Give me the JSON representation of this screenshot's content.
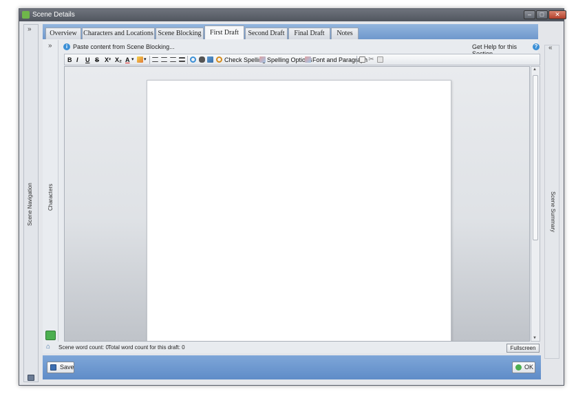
{
  "window": {
    "title": "Scene Details",
    "controls": {
      "minimize": "–",
      "maximize": "□",
      "close": "✕"
    }
  },
  "side_panels": {
    "left_label": "Scene Navigation",
    "left_toggle": "»",
    "characters_label": "Characters",
    "characters_toggle": "»",
    "right_label": "Scene Summary",
    "right_toggle": "«"
  },
  "tabs": [
    {
      "label": "Overview"
    },
    {
      "label": "Characters and Locations"
    },
    {
      "label": "Scene Blocking"
    },
    {
      "label": "First Draft"
    },
    {
      "label": "Second Draft"
    },
    {
      "label": "Final Draft"
    },
    {
      "label": "Notes"
    }
  ],
  "active_tab": "First Draft",
  "top_actions": {
    "paste_label": "Paste content from Scene Blocking...",
    "help_label": "Get Help for this Section..."
  },
  "format_toolbar": {
    "bold": "B",
    "italic": "I",
    "underline": "U",
    "strike": "S",
    "superscript": "X²",
    "subscript": "X₂",
    "font_color": "A",
    "dropdown": "▾",
    "check_spelling": "Check Spelling",
    "spelling_options": "Spelling Options",
    "font_paragraph": "Font and Paragraph"
  },
  "status": {
    "scene_word_count": "Scene word count: 0",
    "total_word_count": "Total word count for this draft: 0",
    "fullscreen": "Fullscreen"
  },
  "bottom": {
    "save": "Save",
    "ok": "OK"
  },
  "colors": {
    "tab_bar": "#7ea6d8",
    "accent_green": "#4caf50",
    "help_blue": "#3a8fd6"
  }
}
